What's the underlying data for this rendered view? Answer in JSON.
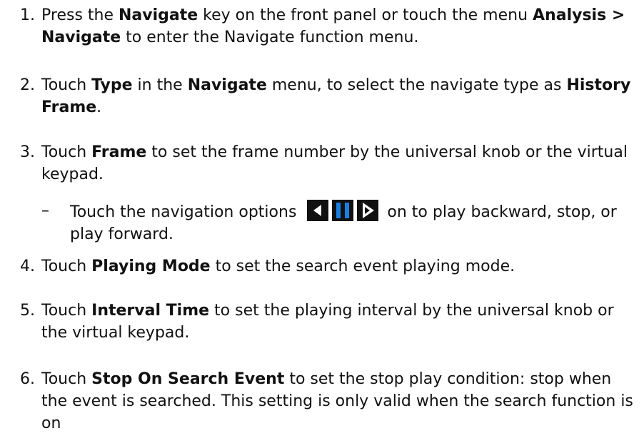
{
  "steps": [
    {
      "number": "1.",
      "parts": [
        {
          "t": "Press the ",
          "b": false
        },
        {
          "t": "Navigate",
          "b": true
        },
        {
          "t": " key on the front panel or touch the menu ",
          "b": false
        },
        {
          "t": "Analysis > Navigate",
          "b": true
        },
        {
          "t": " to enter the Navigate function menu.",
          "b": false
        }
      ]
    },
    {
      "number": "2.",
      "parts": [
        {
          "t": "Touch ",
          "b": false
        },
        {
          "t": "Type",
          "b": true
        },
        {
          "t": " in the ",
          "b": false
        },
        {
          "t": "Navigate",
          "b": true
        },
        {
          "t": " menu, to select the navigate type as ",
          "b": false
        },
        {
          "t": "History Frame",
          "b": true
        },
        {
          "t": ".",
          "b": false
        }
      ]
    },
    {
      "number": "3.",
      "parts": [
        {
          "t": "Touch ",
          "b": false
        },
        {
          "t": "Frame",
          "b": true
        },
        {
          "t": " to set the frame number by the universal knob or the virtual keypad.",
          "b": false
        }
      ]
    },
    {
      "number": "4.",
      "parts": [
        {
          "t": "Touch ",
          "b": false
        },
        {
          "t": "Playing Mode",
          "b": true
        },
        {
          "t": " to set the search event playing mode.",
          "b": false
        }
      ]
    },
    {
      "number": "5.",
      "parts": [
        {
          "t": "Touch ",
          "b": false
        },
        {
          "t": "Interval Time",
          "b": true
        },
        {
          "t": " to set the playing interval by the universal knob or the virtual keypad.",
          "b": false
        }
      ]
    },
    {
      "number": "6.",
      "parts": [
        {
          "t": "Touch ",
          "b": false
        },
        {
          "t": "Stop On Search Event",
          "b": true
        },
        {
          "t": " to set the stop play condition: stop when the event is searched.  This setting is only valid when the search function is on",
          "b": false
        }
      ]
    }
  ],
  "substep": {
    "dash": "–",
    "before": "Touch the navigation options",
    "after": " on to play backward, stop, or play forward.",
    "icons": [
      "play-backward-icon",
      "stop-icon",
      "play-forward-icon"
    ],
    "colors": {
      "backward_bg": "#111111",
      "stop_bg": "#111111",
      "stop_bars": "#1a7fe0",
      "forward_bg": "#111111",
      "glyph": "#ffffff"
    }
  }
}
